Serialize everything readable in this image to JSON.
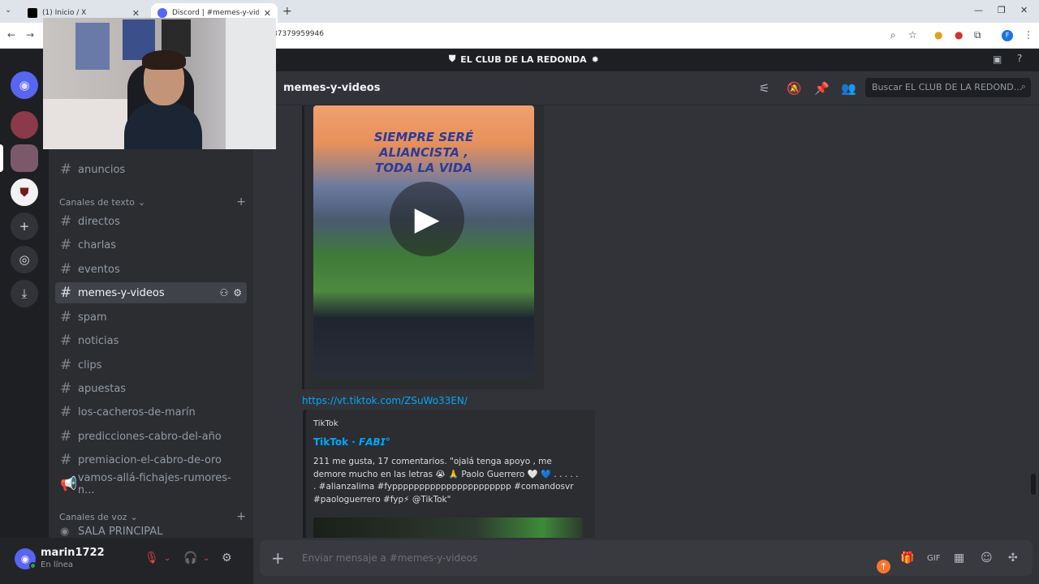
{
  "browser": {
    "tabs": [
      {
        "title": "(1) Inicio / X",
        "active": false
      },
      {
        "title": "Discord | #memes-y-videos | El",
        "active": true
      }
    ],
    "url_fragment": "37379959946",
    "profile_initial": "F"
  },
  "server": {
    "name": "EL CLUB DE LA REDONDA"
  },
  "sidebar": {
    "channels_top": [
      {
        "label": "anuncios"
      }
    ],
    "category_text": "Canales de texto",
    "text_channels": [
      {
        "label": "directos"
      },
      {
        "label": "charlas"
      },
      {
        "label": "eventos"
      },
      {
        "label": "memes-y-videos",
        "active": true
      },
      {
        "label": "spam"
      },
      {
        "label": "noticias"
      },
      {
        "label": "clips"
      },
      {
        "label": "apuestas"
      },
      {
        "label": "los-cacheros-de-marín"
      },
      {
        "label": "predicciones-cabro-del-año"
      },
      {
        "label": "premiacion-el-cabro-de-oro"
      },
      {
        "label": "vamos-allá-fichajes-rumores-n..."
      }
    ],
    "category_voice": "Canales de voz",
    "voice_channels": [
      {
        "label": "SALA PRINCIPAL"
      }
    ]
  },
  "user": {
    "name": "marin1722",
    "status": "En línea"
  },
  "header": {
    "channel": "memes-y-videos",
    "search_placeholder": "Buscar EL CLUB DE LA REDOND..."
  },
  "messages": {
    "video_embed": {
      "overlay_line1": "SIEMPRE SERÉ",
      "overlay_line2": "ALIANCISTA ,",
      "overlay_line3": "TODA LA VIDA"
    },
    "link": "https://vt.tiktok.com/ZSuWo33EN/",
    "tiktok_embed": {
      "provider": "TikTok",
      "title": "TikTok · 𝙁𝘼𝘽𝙄°",
      "description": "211 me gusta, 17 comentarios. \"ojalá tenga apoyo , me demore mucho en las letras 😭 🙏 Paolo Guerrero 🤍 💙 . . . . . . #alianzalima #fypppppppppppppppppppppp #comandosvr #paologuerrero #fyp⚡ @TikTok\""
    }
  },
  "composer": {
    "placeholder": "Enviar mensaje a #memes-y-videos"
  },
  "colors": {
    "accent": "#5865f2",
    "link": "#00a8fc",
    "online": "#23a55a"
  }
}
